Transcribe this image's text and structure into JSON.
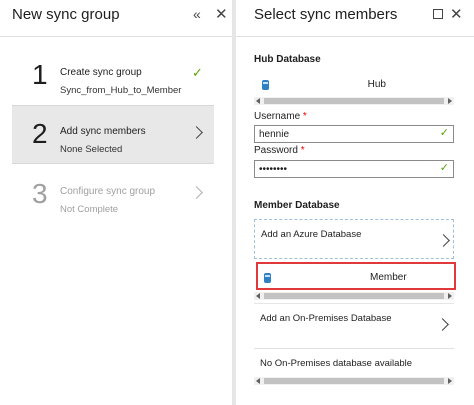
{
  "left_blade": {
    "title": "New sync group",
    "minimize_glyph": "«",
    "close_glyph": "✕",
    "steps": [
      {
        "number": "1",
        "name": "Create sync group",
        "sub": "Sync_from_Hub_to_Member",
        "status": "complete"
      },
      {
        "number": "2",
        "name": "Add sync members",
        "sub": "None Selected",
        "status": "active"
      },
      {
        "number": "3",
        "name": "Configure sync group",
        "sub": "Not Complete",
        "status": "disabled"
      }
    ]
  },
  "right_blade": {
    "title": "Select sync members",
    "close_glyph": "✕",
    "hub": {
      "heading": "Hub Database",
      "database": "Hub",
      "username_label": "Username",
      "username_value": "hennie",
      "password_label": "Password",
      "password_value": "••••••••",
      "required_mark": "*"
    },
    "member": {
      "heading": "Member Database",
      "add_azure_label": "Add an Azure Database",
      "selected_database": "Member",
      "add_onprem_label": "Add an On-Premises Database",
      "onprem_status": "No On-Premises database available"
    }
  },
  "colors": {
    "accent_check": "#57a300",
    "highlight_border": "#e0383b",
    "db_icon": "#2f7fc5",
    "selected_step_bg": "#e8e8e8"
  },
  "icons": {
    "complete": "checkmark-icon",
    "next": "chevron-right-icon",
    "database": "sql-database-icon"
  }
}
